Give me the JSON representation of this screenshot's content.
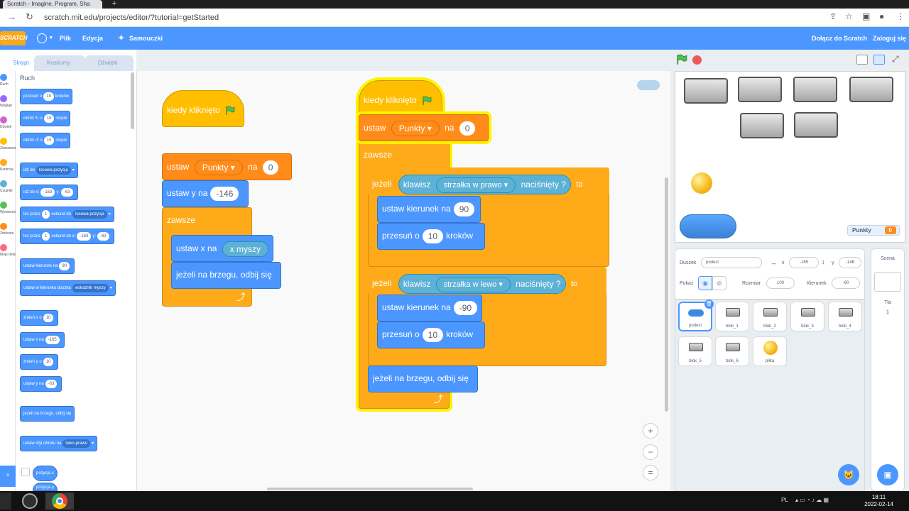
{
  "browser": {
    "tab_title": "Scratch - Imagine, Program, Sha",
    "url": "scratch.mit.edu/projects/editor/?tutorial=getStarted"
  },
  "menubar": {
    "logo": "SCRATCH",
    "file": "Plik",
    "edit": "Edycja",
    "tutorials": "Samouczki",
    "join": "Dołącz do Scratch",
    "login": "Zaloguj się"
  },
  "editor_tabs": {
    "code": "Skrypt",
    "costumes": "Kostiumy",
    "sounds": "Dźwięki"
  },
  "categories": [
    {
      "label": "Ruch",
      "color": "#4c97ff"
    },
    {
      "label": "Wygląd",
      "color": "#9966ff"
    },
    {
      "label": "Dźwięk",
      "color": "#cf63cf"
    },
    {
      "label": "Zdarzenia",
      "color": "#ffbf00"
    },
    {
      "label": "Kontrola",
      "color": "#ffab19"
    },
    {
      "label": "Czujniki",
      "color": "#5cb1d6"
    },
    {
      "label": "Wyrażenia",
      "color": "#59c059"
    },
    {
      "label": "Zmienne",
      "color": "#ff8c1a"
    },
    {
      "label": "Moje bloki",
      "color": "#ff6680"
    }
  ],
  "palette": {
    "title": "Ruch",
    "move": {
      "a": "przesuń o",
      "v": "10",
      "b": "kroków"
    },
    "turn_right": {
      "a": "obróć",
      "v": "15",
      "b": "stopni"
    },
    "turn_left": {
      "a": "obróć",
      "v": "15",
      "b": "stopni"
    },
    "goto": {
      "a": "idź do",
      "dd": "losowa pozycja"
    },
    "goto_xy": {
      "a": "idź do x:",
      "x": "-163",
      "b": "y:",
      "y": "-63"
    },
    "glide": {
      "a": "leć przez",
      "v": "1",
      "b": "sekund do",
      "dd": "losowa pozycja"
    },
    "glide_xy": {
      "a": "leć przez",
      "v": "1",
      "b": "sekund do x:",
      "x": "-163",
      "c": "y:",
      "y": "-63"
    },
    "point_dir": {
      "a": "ustaw kierunek na",
      "v": "90"
    },
    "point_towards": {
      "a": "ustaw w kierunku duszka",
      "dd": "wskaźnik myszy"
    },
    "change_x": {
      "a": "zmień x o",
      "v": "10"
    },
    "set_x": {
      "a": "ustaw x na",
      "v": "-165"
    },
    "change_y": {
      "a": "zmień y o",
      "v": "10"
    },
    "set_y": {
      "a": "ustaw y na",
      "v": "-63"
    },
    "bounce": "jeżeli na brzegu, odbij się",
    "rotation": {
      "a": "ustaw styl obrotu na",
      "dd": "lewo-prawo"
    },
    "pos_x": "pozycja x",
    "pos_y": "pozycja y"
  },
  "script1": {
    "hat": "kiedy kliknięto",
    "set_var": {
      "a": "ustaw",
      "var": "Punkty",
      "b": "na",
      "v": "0"
    },
    "set_y": {
      "a": "ustaw y na",
      "v": "-146"
    },
    "forever": "zawsze",
    "set_x": {
      "a": "ustaw x na",
      "rep": "x myszy"
    },
    "bounce": "jeżeli na brzegu, odbij się"
  },
  "script2": {
    "hat": "kiedy kliknięto",
    "set_var": {
      "a": "ustaw",
      "var": "Punkty",
      "b": "na",
      "v": "0"
    },
    "forever": "zawsze",
    "if1": {
      "a": "jeżeli",
      "k": "klawisz",
      "key": "strzałka w prawo",
      "p": "naciśnięty ?",
      "to": "to"
    },
    "dir1": {
      "a": "ustaw kierunek na",
      "v": "90"
    },
    "move1": {
      "a": "przesuń o",
      "v": "10",
      "b": "kroków"
    },
    "if2": {
      "a": "jeżeli",
      "k": "klawisz",
      "key": "strzałka w lewo",
      "p": "naciśnięty ?",
      "to": "to"
    },
    "dir2": {
      "a": "ustaw kierunek na",
      "v": "-90"
    },
    "move2": {
      "a": "przesuń o",
      "v": "10",
      "b": "kroków"
    },
    "bounce": "jeżeli na brzegu, odbij się"
  },
  "stage": {
    "monitor_label": "Punkty",
    "monitor_value": "0"
  },
  "sprite_info": {
    "sprite_label": "Duszek",
    "sprite_name": "podest",
    "x_label": "x",
    "x": "-165",
    "y_label": "y",
    "y": "-146",
    "show_label": "Pokaż",
    "size_label": "Rozmiar",
    "size": "100",
    "dir_label": "Kierunek",
    "direction": "-90"
  },
  "sprites": [
    {
      "name": "podest"
    },
    {
      "name": "blok_1"
    },
    {
      "name": "blok_2"
    },
    {
      "name": "blok_3"
    },
    {
      "name": "blok_4"
    },
    {
      "name": "blok_5"
    },
    {
      "name": "blok_6"
    },
    {
      "name": "piłka"
    }
  ],
  "stage_pane": {
    "title": "Scena",
    "backdrops_label": "Tła",
    "backdrops_count": "1"
  },
  "taskbar": {
    "lang": "PL",
    "time": "18:11",
    "date": "2022-02-14"
  }
}
